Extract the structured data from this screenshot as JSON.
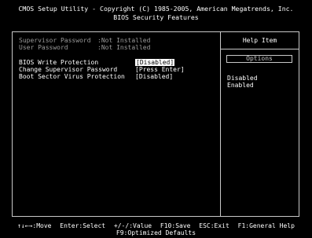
{
  "header": {
    "title_line1": "CMOS Setup Utility - Copyright (C) 1985-2005, American Megatrends, Inc.",
    "title_line2": "BIOS Security Features"
  },
  "main": {
    "supervisor_password": {
      "label": "Supervisor Password",
      "value": ":Not Installed"
    },
    "user_password": {
      "label": "User Password",
      "value": ":Not Installed"
    },
    "items": [
      {
        "label": "BIOS Write Protection",
        "value": "[Disabled]"
      },
      {
        "label": "Change Supervisor Password",
        "value": "[Press Enter]"
      },
      {
        "label": "Boot Sector Virus Protection",
        "value": "[Disabled]"
      }
    ]
  },
  "help": {
    "title": "Help Item",
    "options_label": "Options",
    "options": [
      "Disabled",
      "Enabled"
    ]
  },
  "footer": {
    "move": "↑↓←→:Move",
    "enter": "Enter:Select",
    "value": "+/-/:Value",
    "save": "F10:Save",
    "exit": "ESC:Exit",
    "help": "F1:General Help",
    "defaults": "F9:Optimized Defaults"
  },
  "colors": {
    "background": "#000000",
    "text": "#ffffff",
    "dim_text": "#9a9a9a",
    "frame": "#c8c8c8",
    "highlight_bg": "#ffffff",
    "highlight_fg": "#000000"
  }
}
